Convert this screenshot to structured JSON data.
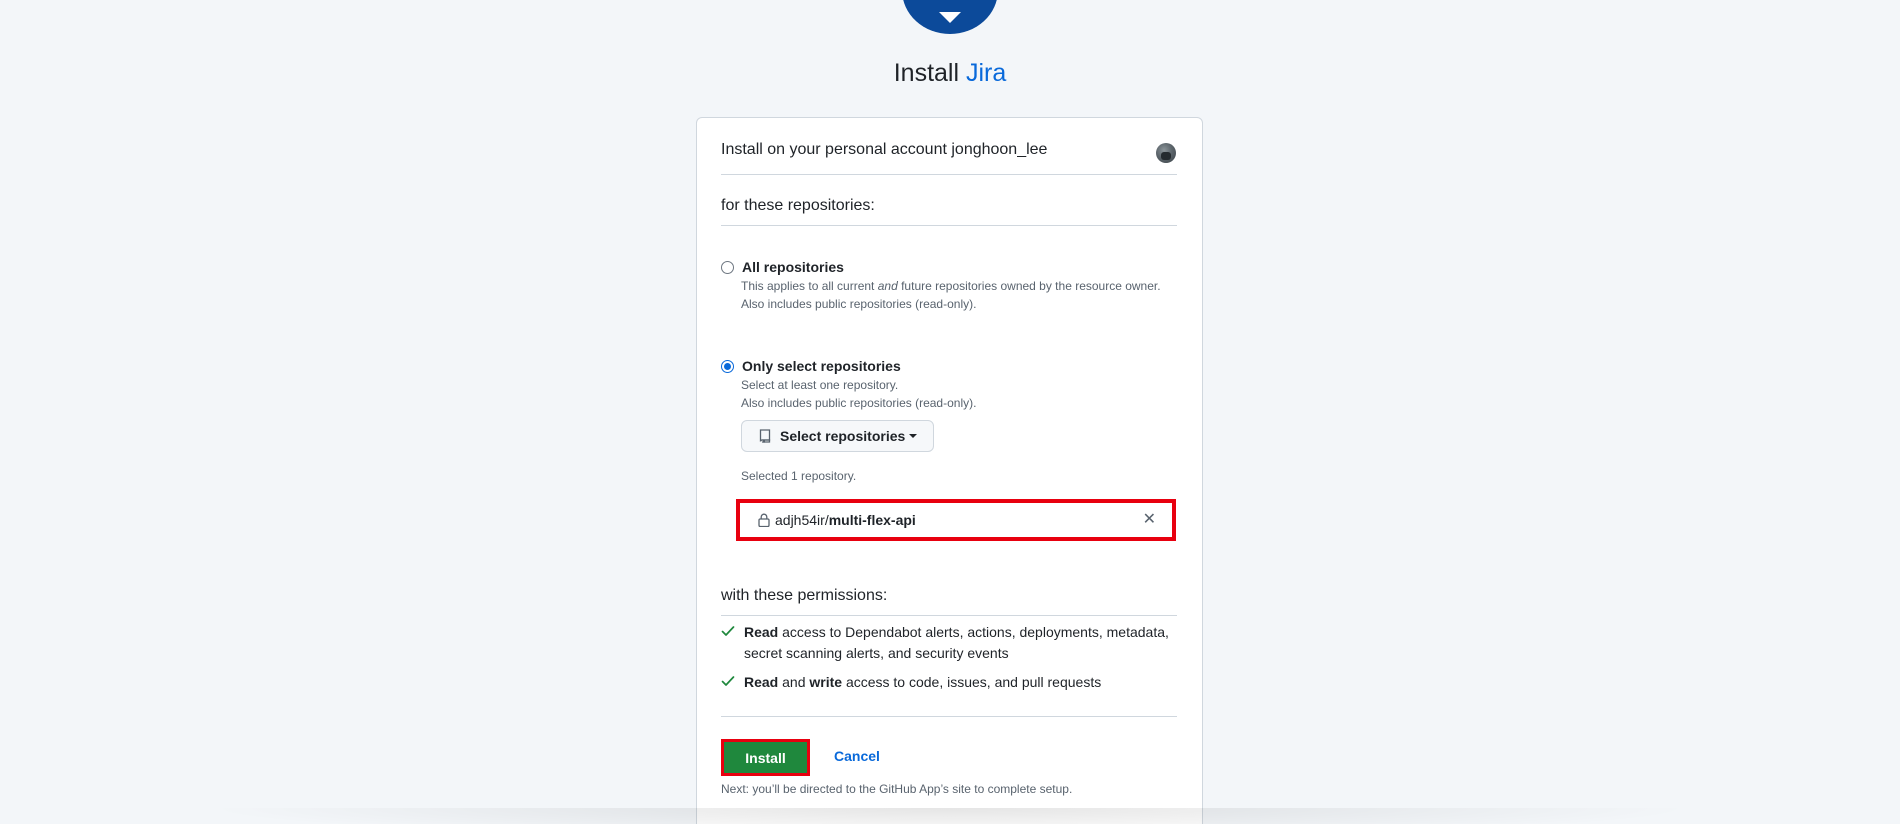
{
  "header": {
    "title_prefix": "Install",
    "app_name": "Jira"
  },
  "account": {
    "label": "Install on your personal account jonghoon_lee"
  },
  "repositories": {
    "heading": "for these repositories:",
    "all": {
      "label": "All repositories",
      "note_before": "This applies to all current ",
      "note_em": "and",
      "note_after": " future repositories owned by the resource owner.",
      "note2": "Also includes public repositories (read-only).",
      "checked": false
    },
    "select": {
      "label": "Only select repositories",
      "note1": "Select at least one repository.",
      "note2": "Also includes public repositories (read-only).",
      "checked": true
    },
    "select_button_label": "Select repositories",
    "selected_count": "Selected 1 repository.",
    "selected_item": {
      "owner": "adjh54ir/",
      "name": "multi-flex-api"
    }
  },
  "permissions": {
    "heading": "with these permissions:",
    "items": [
      {
        "bold1": "Read",
        "text": " access to Dependabot alerts, actions, deployments, metadata, secret scanning alerts, and security events"
      },
      {
        "bold1": "Read",
        "mid": " and ",
        "bold2": "write",
        "text": " access to code, issues, and pull requests"
      }
    ]
  },
  "actions": {
    "install_label": "Install",
    "cancel_label": "Cancel",
    "next_note": "Next: you’ll be directed to the GitHub App’s site to complete setup."
  },
  "colors": {
    "accent": "#0969da",
    "install_green": "#1f883d",
    "highlight_red": "#e8000f",
    "logo_blue": "#0c4a9a"
  }
}
